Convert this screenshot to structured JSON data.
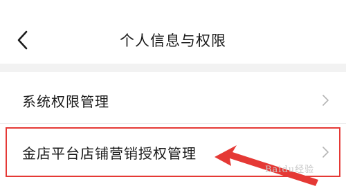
{
  "header": {
    "title": "个人信息与权限",
    "back_icon": "chevron-left-icon"
  },
  "menu": {
    "items": [
      {
        "label": "系统权限管理",
        "icon": "chevron-right-icon"
      },
      {
        "label": "金店平台店铺营销授权管理",
        "icon": "chevron-right-icon"
      }
    ]
  },
  "annotation": {
    "highlight_color": "#e53935",
    "arrow_color": "#e53935"
  },
  "watermark": {
    "text": "Baidu经验"
  }
}
